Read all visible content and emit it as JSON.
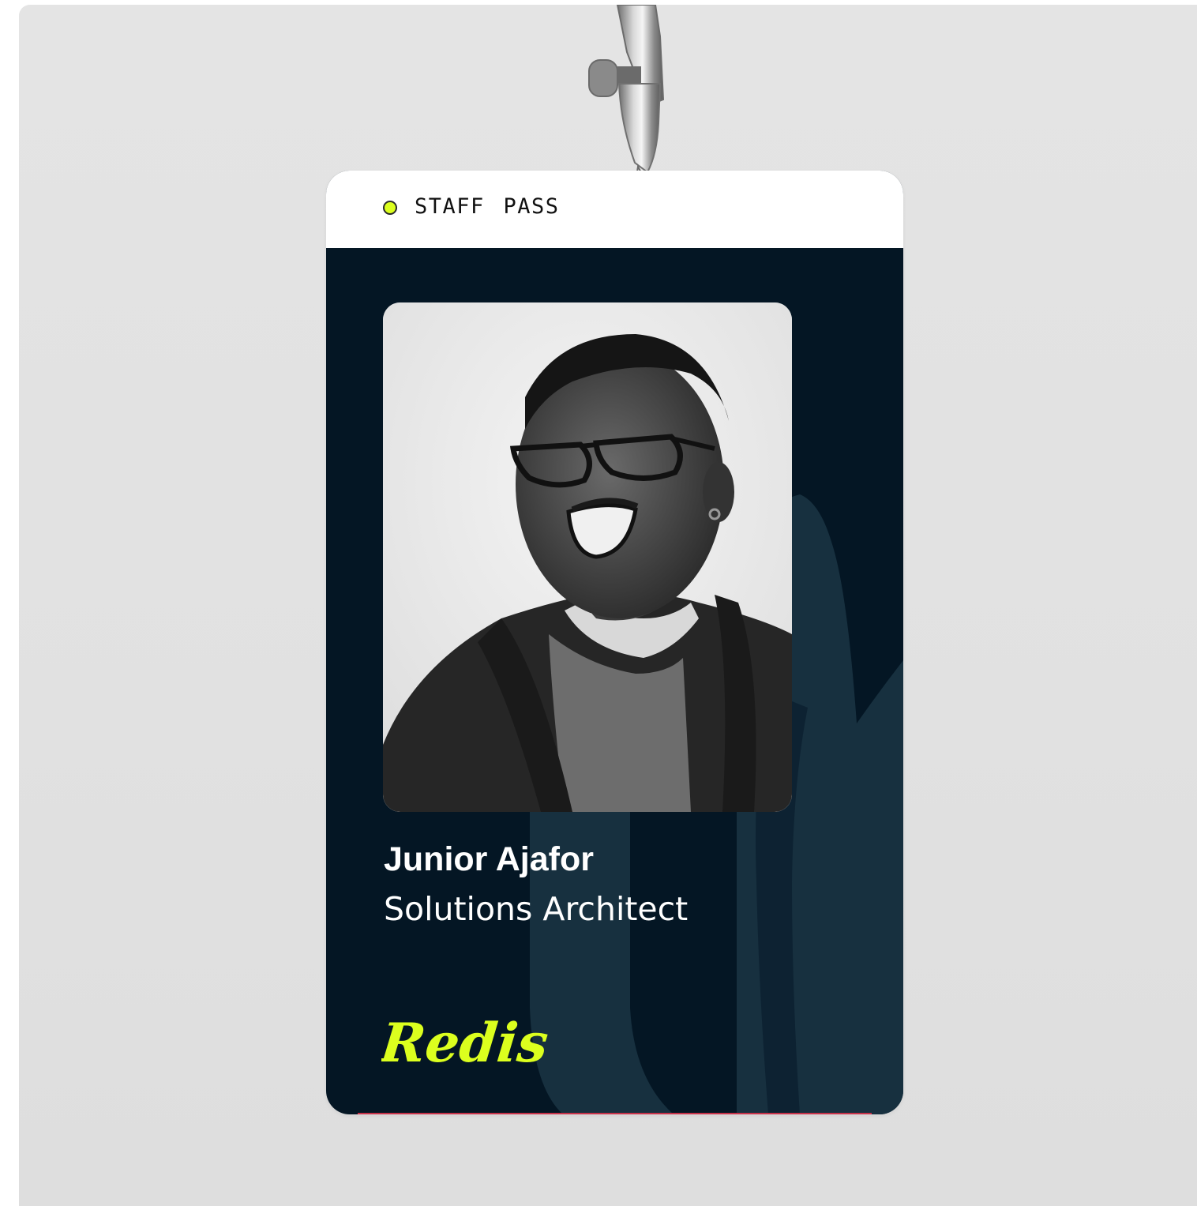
{
  "badge": {
    "label": "STAFF PASS",
    "status_color": "#dcff1e",
    "card_color": "#041624",
    "watermark_color": "#1a3446"
  },
  "person": {
    "name": "Junior Ajafor",
    "role": "Solutions Architect",
    "photo": "black-and-white portrait"
  },
  "brand": {
    "logo_text": "Redis",
    "logo_color": "#dcff1e"
  }
}
